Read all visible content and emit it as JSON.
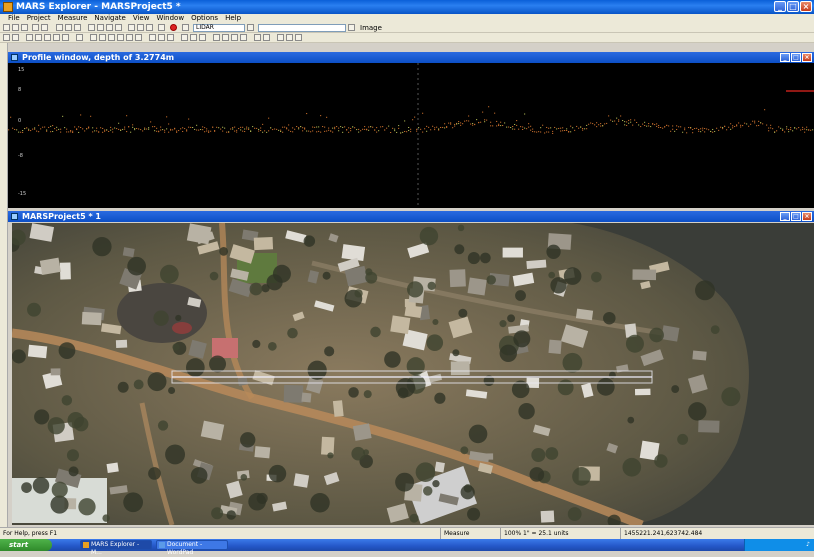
{
  "app": {
    "title": "MARS Explorer - MARSProject5 *"
  },
  "menu": [
    "File",
    "Project",
    "Measure",
    "Navigate",
    "View",
    "Window",
    "Options",
    "Help"
  ],
  "toolbar": {
    "layer_combo": "LIDAR",
    "image_label": "Image"
  },
  "profile_window": {
    "title": "Profile window, depth of 3.2774m",
    "y_axis_labels": [
      "15",
      "8",
      "0",
      "-8",
      "-15"
    ]
  },
  "map_window": {
    "title": "MARSProject5 * 1"
  },
  "statusbar": {
    "hint": "For Help, press F1",
    "mode": "Measure",
    "scale": "100% 1\" = 25.1 units",
    "coords": "1455221.241,623742.484"
  },
  "taskbar": {
    "start_label": "start",
    "tasks": [
      "MARS Explorer - M...",
      "Document - WordPad"
    ]
  },
  "colors": {
    "title_blue": "#0a5fd8",
    "profile_bg": "#000000",
    "profile_points": "#c06a2a",
    "water": "#3a3d38"
  }
}
